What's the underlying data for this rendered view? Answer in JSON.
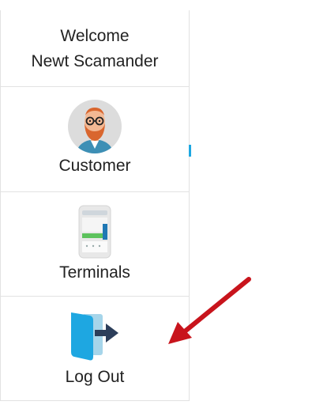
{
  "welcome": {
    "greeting": "Welcome",
    "user_name": "Newt Scamander"
  },
  "menu": {
    "items": [
      {
        "label": "Customer",
        "icon": "customer-avatar-icon"
      },
      {
        "label": "Terminals",
        "icon": "terminal-device-icon"
      },
      {
        "label": "Log Out",
        "icon": "logout-door-icon"
      }
    ]
  },
  "colors": {
    "accent": "#1ea7e1",
    "annotation_arrow": "#c8141c",
    "border": "#e2e2e2"
  }
}
